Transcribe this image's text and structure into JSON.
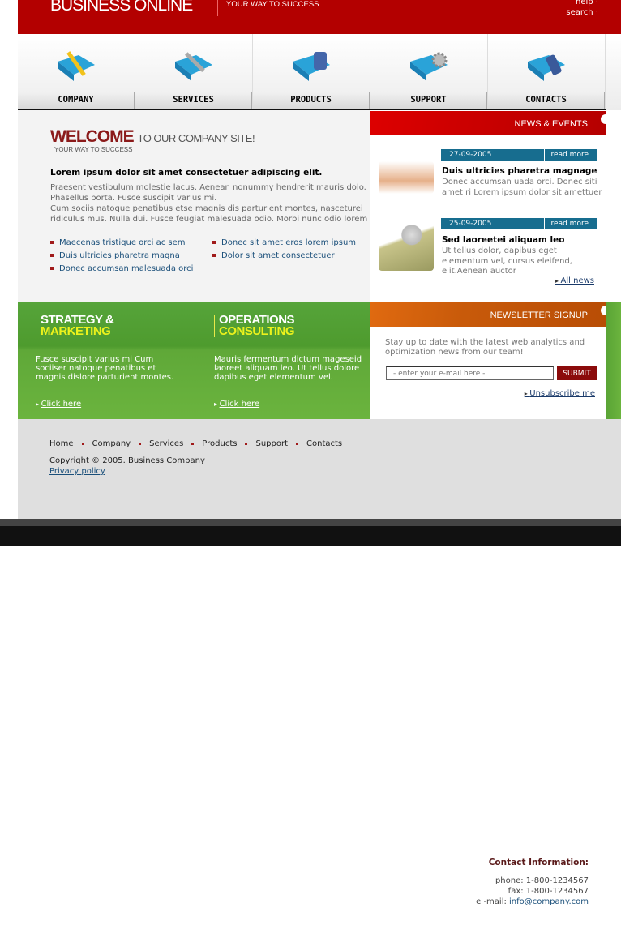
{
  "header": {
    "logo": "BUSINESS ONLINE",
    "tagline": "YOUR WAY TO SUCCESS",
    "links": [
      "help",
      "search"
    ]
  },
  "nav": [
    {
      "label": "COMPANY",
      "icon": "pencil-folder-icon"
    },
    {
      "label": "SERVICES",
      "icon": "wrench-folder-icon"
    },
    {
      "label": "PRODUCTS",
      "icon": "device-folder-icon"
    },
    {
      "label": "SUPPORT",
      "icon": "gear-folder-icon"
    },
    {
      "label": "CONTACTS",
      "icon": "phone-folder-icon"
    }
  ],
  "welcome": {
    "title": "WELCOME",
    "title_rest": "TO OUR COMPANY SITE!",
    "subtitle": "YOUR WAY TO SUCCESS",
    "lead": "Lorem ipsum dolor sit amet consectetuer adipiscing elit.",
    "body1": "Praesent vestibulum molestie lacus. Aenean nonummy hendrerit mauris dolo. Phasellus porta. Fusce suscipit varius mi.",
    "body2": "Cum sociis natoque penatibus etse magnis dis parturient montes, nasceturei ridiculus mus. Nulla dui. Fusce feugiat malesuada odio. Morbi nunc odio lorem",
    "links": [
      "Maecenas tristique orci ac sem",
      "Duis ultricies pharetra magna",
      "Donec accumsan malesuada orci",
      "Donec sit amet eros lorem ipsum",
      "Dolor sit amet consectetuer"
    ]
  },
  "news": {
    "title": "NEWS & EVENTS",
    "read_more": "read more",
    "all_news": "All news",
    "items": [
      {
        "date": "27-09-2005",
        "title": "Duis ultricies pharetra magnage",
        "text": "Donec accumsan uada orci. Donec siti amet ri Lorem ipsum dolor sit amettuer"
      },
      {
        "date": "25-09-2005",
        "title": "Sed laoreetei aliquam leo",
        "text": "Ut tellus dolor, dapibus eget elementum vel, cursus eleifend, elit.Aenean auctor"
      }
    ]
  },
  "features": [
    {
      "line1": "STRATEGY &",
      "line2": "MARKETING",
      "text": "Fusce suscipit varius mi Cum sociiser natoque penatibus et magnis dislore parturient montes.",
      "link": "Click here"
    },
    {
      "line1": "OPERATIONS",
      "line2": "CONSULTING",
      "text": "Mauris fermentum dictum mageseid laoreet aliquam leo. Ut tellus dolore dapibus eget elementum vel.",
      "link": "Click here"
    }
  ],
  "newsletter": {
    "title": "NEWSLETTER SIGNUP",
    "text": "Stay up to date with the latest web analytics and optimization news from our team!",
    "placeholder": "- enter your e-mail here -",
    "submit": "SUBMIT",
    "unsubscribe": "Unsubscribe me"
  },
  "footer": {
    "links": [
      "Home",
      "Company",
      "Services",
      "Products",
      "Support",
      "Contacts"
    ],
    "copyright": "Copyright © 2005. Business Company",
    "privacy": "Privacy policy",
    "contact": {
      "title": "Contact Information:",
      "phone": "phone: 1-800-1234567",
      "fax": "fax: 1-800-1234567",
      "email_label": "e -mail:",
      "email": "info@company.com"
    }
  },
  "colors": {
    "brand_red": "#b30000",
    "green": "#56a43a",
    "news_bar": "#176d8f",
    "orange": "#c85a0a"
  }
}
